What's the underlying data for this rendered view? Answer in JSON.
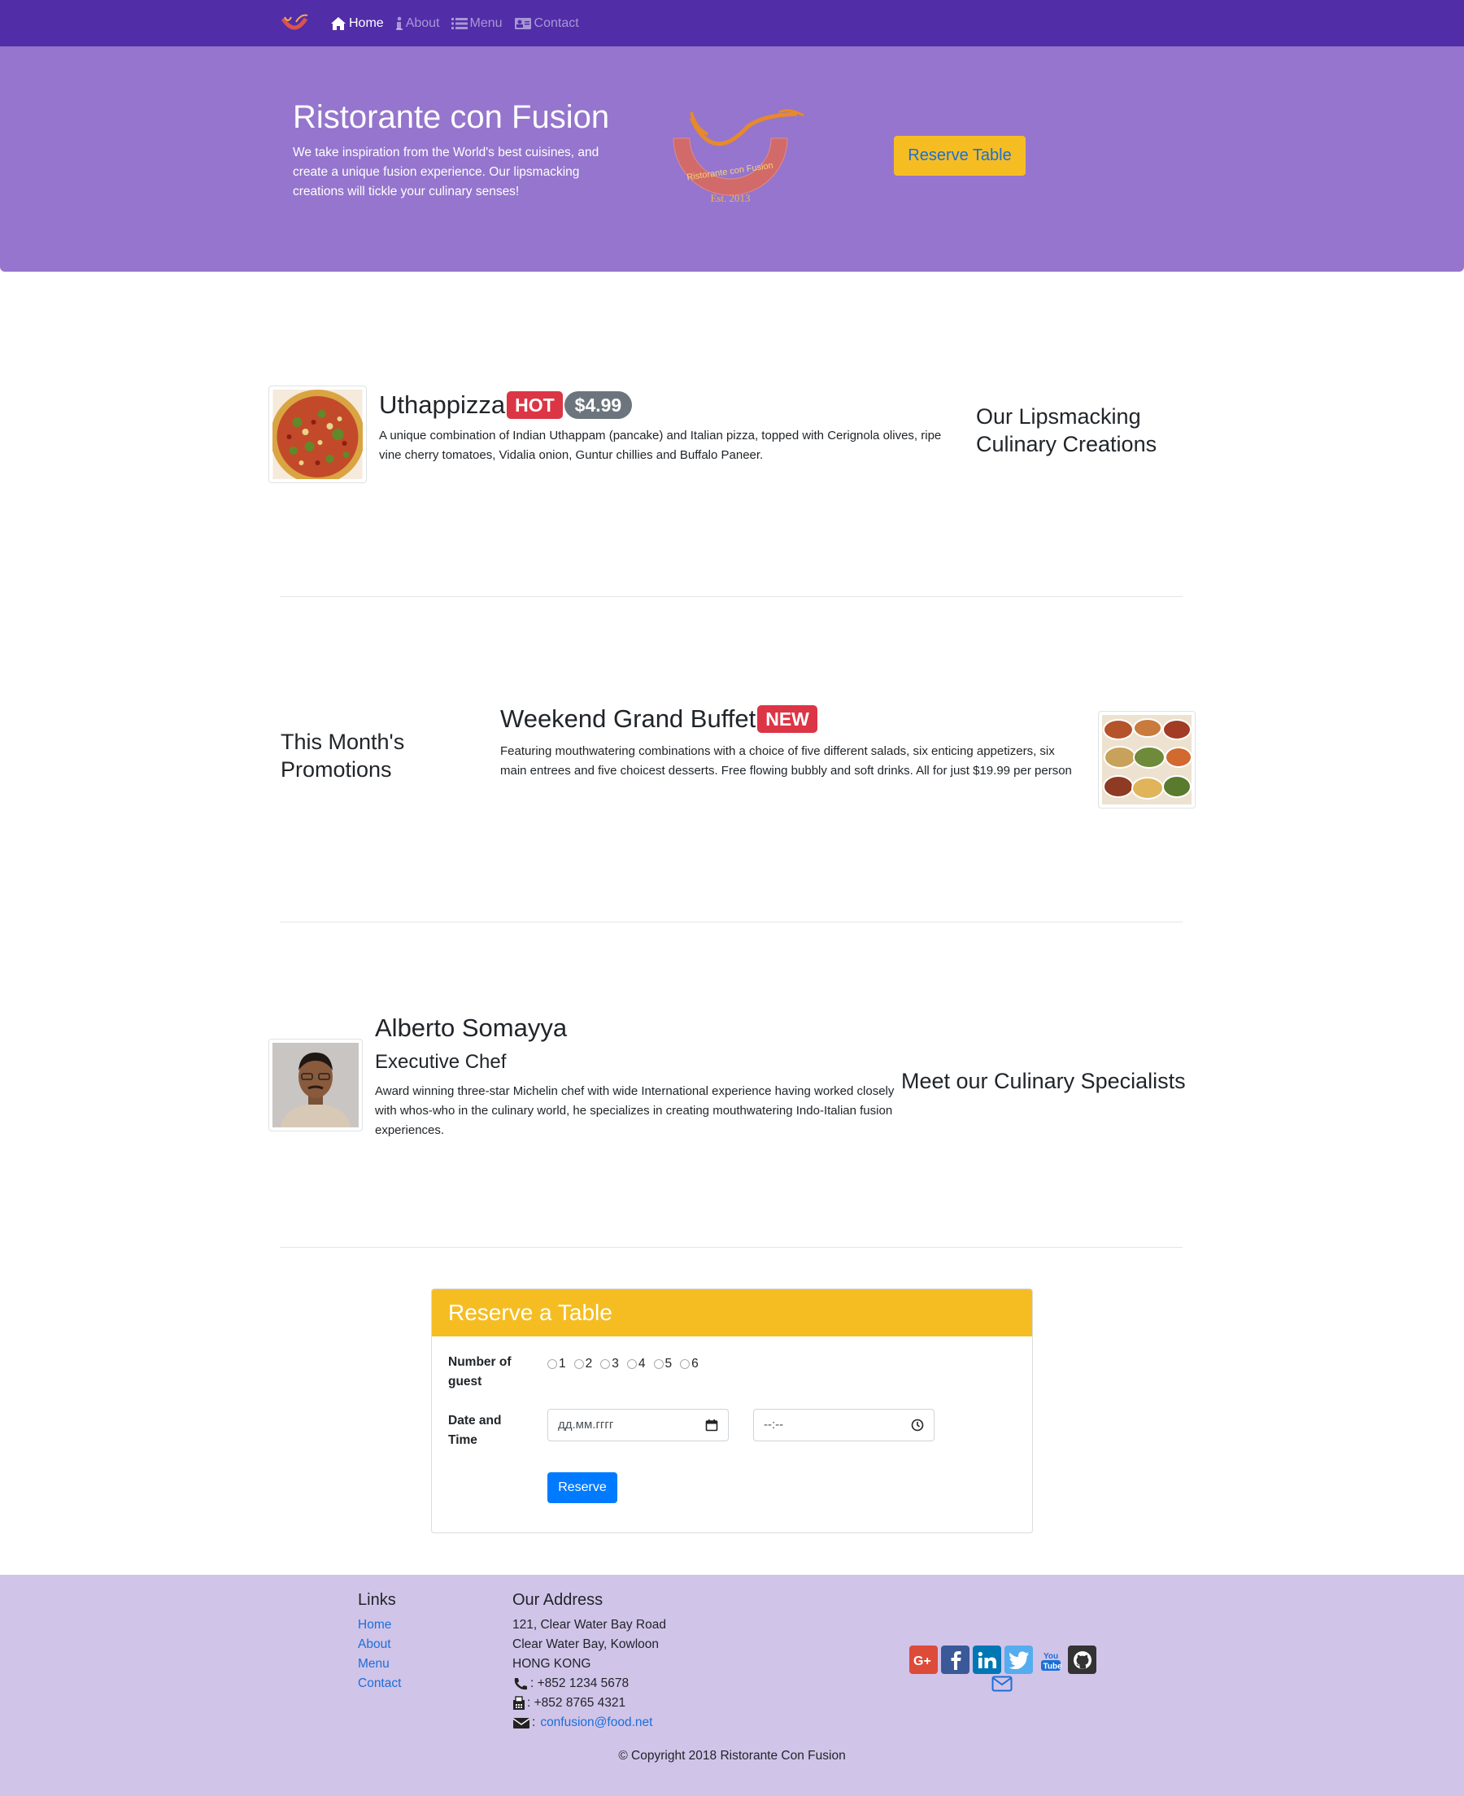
{
  "nav": {
    "items": [
      {
        "label": "Home",
        "active": true
      },
      {
        "label": "About",
        "active": false
      },
      {
        "label": "Menu",
        "active": false
      },
      {
        "label": "Contact",
        "active": false
      }
    ]
  },
  "hero": {
    "title": "Ristorante con Fusion",
    "text": "We take inspiration from the World's best cuisines, and create a unique fusion experience. Our lipsmacking creations will tickle your culinary senses!",
    "logo_text": "Ristorante con Fusion",
    "logo_est": "Est. 2013",
    "reserve_button": "Reserve Table"
  },
  "dish": {
    "name": "Uthappizza",
    "label": "HOT",
    "price": "$4.99",
    "description": "A unique combination of Indian Uthappam (pancake) and Italian pizza, topped with Cerignola olives, ripe vine cherry tomatoes, Vidalia onion, Guntur chillies and Buffalo Paneer.",
    "section_heading": "Our Lipsmacking Culinary Creations"
  },
  "promotion": {
    "section_heading": "This Month's Promotions",
    "name": "Weekend Grand Buffet",
    "label": "NEW",
    "description": "Featuring mouthwatering combinations with a choice of five different salads, six enticing appetizers, six main entrees and five choicest desserts. Free flowing bubbly and soft drinks. All for just $19.99 per person"
  },
  "leader": {
    "name": "Alberto Somayya",
    "designation": "Executive Chef",
    "description": "Award winning three-star Michelin chef with wide International experience having worked closely with whos-who in the culinary world, he specializes in creating mouthwatering Indo-Italian fusion experiences.",
    "section_heading": "Meet our Culinary Specialists"
  },
  "reservation": {
    "title": "Reserve a Table",
    "guests_label": "Number of guest",
    "guest_options": [
      "1",
      "2",
      "3",
      "4",
      "5",
      "6"
    ],
    "datetime_label": "Date and Time",
    "date_placeholder": "дд.мм.гггг",
    "time_placeholder": "--:--",
    "submit": "Reserve"
  },
  "footer": {
    "links_heading": "Links",
    "links": [
      "Home",
      "About",
      "Menu",
      "Contact"
    ],
    "address_heading": "Our Address",
    "address_lines": [
      "121, Clear Water Bay Road",
      "Clear Water Bay, Kowloon",
      "HONG KONG"
    ],
    "phone": ": +852 1234 5678",
    "fax": ": +852 8765 4321",
    "email": "confusion@food.net",
    "socials": [
      "google-plus",
      "facebook",
      "linkedin",
      "twitter",
      "youtube",
      "github"
    ],
    "copyright": "© Copyright 2018 Ristorante Con Fusion"
  },
  "colors": {
    "navbar": "#512da8",
    "jumbotron": "#9575cd",
    "footer": "#d1c4e9",
    "accent_yellow": "#f6bd23",
    "badge_red": "#dc3545",
    "link_blue": "#1a6fd8"
  }
}
